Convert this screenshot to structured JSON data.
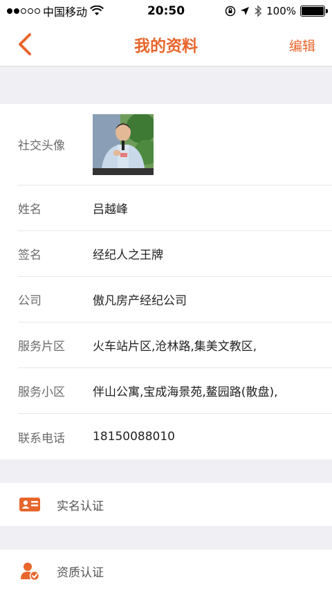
{
  "status_bar": {
    "carrier": "中国移动",
    "time": "20:50",
    "battery_text": "100%",
    "battery_level": 1.0
  },
  "nav": {
    "title": "我的资料",
    "edit_label": "编辑",
    "back_icon": "chevron-left-icon"
  },
  "profile": {
    "avatar_label": "社交头像",
    "fields": [
      {
        "label": "姓名",
        "value": "吕越峰"
      },
      {
        "label": "签名",
        "value": "经纪人之王牌"
      },
      {
        "label": "公司",
        "value": "傲凡房产经纪公司"
      },
      {
        "label": "服务片区",
        "value": "火车站片区,沧林路,集美文教区,"
      },
      {
        "label": "服务小区",
        "value": "伴山公寓,宝成海景苑,鳌园路(散盘),"
      },
      {
        "label": "联系电话",
        "value": "18150088010"
      }
    ]
  },
  "actions": {
    "real_name": {
      "label": "实名认证",
      "icon": "id-card-icon"
    },
    "qualification": {
      "label": "资质认证",
      "icon": "verified-user-icon"
    }
  },
  "colors": {
    "accent": "#e8652b",
    "background": "#efeff4"
  }
}
